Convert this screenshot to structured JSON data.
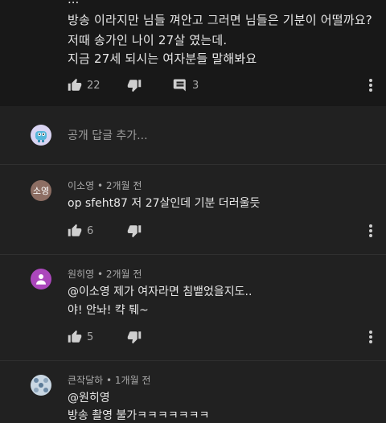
{
  "top_comment": {
    "cut_line": "...",
    "lines": [
      "방송 이라지만 님들 껴안고 그러면 님들은 기분이 어떨까요?",
      "저때 송가인 나이 27살 였는데.",
      "지금 27세 되시는 여자분들 말해봐요"
    ],
    "likes": "22",
    "replies": "3"
  },
  "reply_input": {
    "placeholder": "공개 답글 추가..."
  },
  "replies": [
    {
      "avatar_text": "소영",
      "avatar_color": "#8d6e63",
      "author": "이소영",
      "time": "2개월 전",
      "lines": [
        "op sfeht87 저 27살인데 기분 더러울듯"
      ],
      "likes": "6"
    },
    {
      "avatar_text": "",
      "avatar_color": "#ab47bc",
      "author": "원히영",
      "time": "2개월 전",
      "lines": [
        "@이소영 제가 여자라면 침뱉었을지도..",
        "야! 안놔!  캭 퉤~"
      ],
      "likes": "5"
    },
    {
      "avatar_text": "",
      "avatar_color": "#b3c7d6",
      "author": "큰작달하",
      "time": "1개월 전",
      "lines": [
        "@원히영",
        "방송 촬영 불가ㅋㅋㅋㅋㅋㅋㅋ"
      ],
      "likes": ""
    }
  ],
  "separator": " • "
}
